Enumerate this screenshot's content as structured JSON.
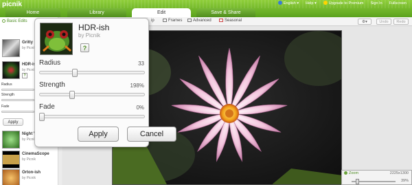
{
  "app": {
    "logo": "picnik"
  },
  "top_links": {
    "language": "English",
    "help": "Help",
    "upgrade": "Upgrade to Premium",
    "sign_in": "Sign In",
    "fullscreen": "Fullscreen"
  },
  "tabs": [
    {
      "label": "Home",
      "active": false
    },
    {
      "label": "Library",
      "active": false
    },
    {
      "label": "Edit",
      "active": true
    },
    {
      "label": "Save & Share",
      "active": false
    }
  ],
  "toolbar": {
    "partial_label": "ip",
    "frames_label": "Frames",
    "advanced_label": "Advanced",
    "seasonal_label": "Seasonal",
    "gear_label": "▾",
    "undo_label": "Undo",
    "redo_label": "Redo"
  },
  "left_panel": {
    "section_label": "Basic Edits",
    "effects": [
      {
        "name": "Gritty",
        "by": "by Picnik"
      },
      {
        "name": "HDR-ish",
        "by": "by Picnik"
      },
      {
        "name": "Night V",
        "by": "by Picnik"
      },
      {
        "name": "CinemaScope",
        "by": "by Picnik"
      },
      {
        "name": "Orton-ish",
        "by": "by Picnik"
      }
    ],
    "mini_sliders": [
      "Radius",
      "Strength",
      "Fade"
    ],
    "mini_apply": "Apply",
    "help_glyph": "?"
  },
  "dialog": {
    "title": "HDR-ish",
    "by": "by Picnik",
    "help_glyph": "?",
    "sliders": [
      {
        "label": "Radius",
        "value_text": "33",
        "level": 0.33
      },
      {
        "label": "Strength",
        "value_text": "198%",
        "level": 0.3
      },
      {
        "label": "Fade",
        "value_text": "0%",
        "level": 0.0
      }
    ],
    "apply_label": "Apply",
    "cancel_label": "Cancel"
  },
  "zoom": {
    "label": "Zoom",
    "dimensions": "2225x1300",
    "percent": "39%",
    "level": 0.1
  },
  "colors": {
    "brand_green": "#5aa21d",
    "accent_green": "#4a8a1e"
  }
}
